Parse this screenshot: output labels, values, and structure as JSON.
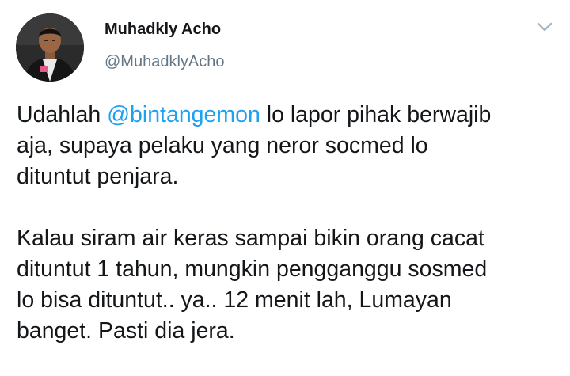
{
  "author": {
    "display_name": "Muhadkly Acho",
    "handle": "@MuhadklyAcho"
  },
  "tweet": {
    "para1_before": "Udahlah ",
    "mention": "@bintangemon",
    "para1_after": " lo lapor pihak berwajib\naja, supaya pelaku yang neror socmed lo\ndituntut penjara.",
    "para2": "Kalau siram air keras sampai bikin orang cacat\ndituntut 1 tahun, mungkin pengganggu sosmed\nlo bisa dituntut.. ya.. 12 menit lah, Lumayan\nbanget. Pasti dia jera."
  },
  "icons": {
    "menu": "chevron-down-icon",
    "avatar": "avatar"
  },
  "colors": {
    "text": "#14171a",
    "secondary": "#657786",
    "link": "#1da1f2"
  }
}
